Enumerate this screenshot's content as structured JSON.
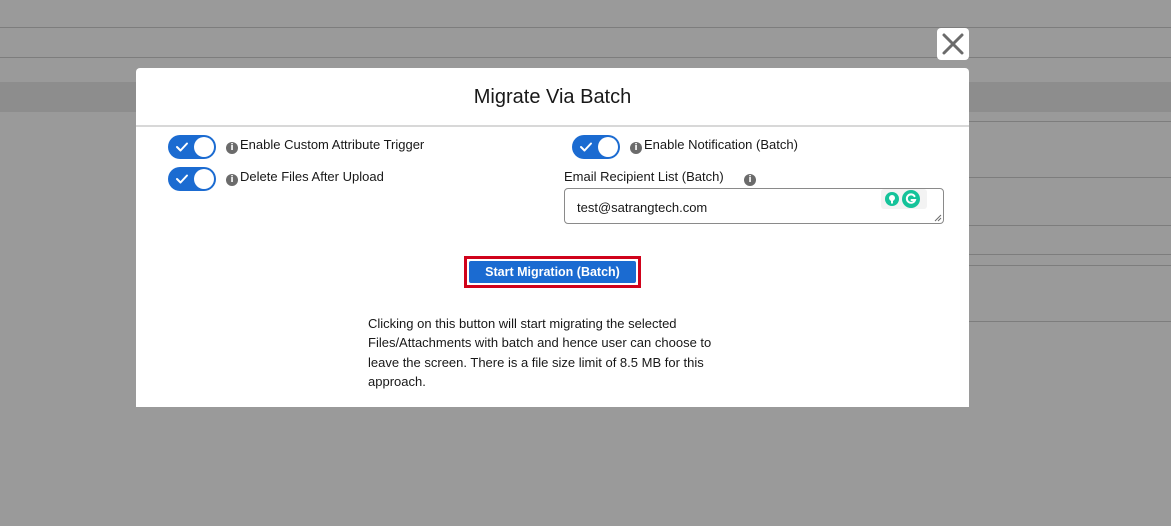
{
  "modal": {
    "title": "Migrate Via Batch",
    "left_toggles": [
      {
        "label": "Enable Custom Attribute Trigger",
        "on": true
      },
      {
        "label": "Delete Files After Upload",
        "on": true
      }
    ],
    "right_toggles": [
      {
        "label": "Enable Notification (Batch)",
        "on": true
      }
    ],
    "email": {
      "label": "Email Recipient List (Batch)",
      "value": "test@satrangtech.com"
    },
    "start_button_label": "Start Migration (Batch)",
    "description_lines": [
      "Clicking on this button will start migrating the selected",
      "Files/Attachments with batch and hence user can choose to",
      "leave the screen. There is a file size limit of 8.5 MB for this",
      "approach."
    ]
  },
  "icons": {
    "close": "close-icon",
    "info": "info-icon",
    "check": "check-icon",
    "grammarly": "grammarly-icon"
  },
  "colors": {
    "accent": "#1b6bd1",
    "highlight_border": "#d0021b",
    "overlay": "#9a9a9a"
  }
}
